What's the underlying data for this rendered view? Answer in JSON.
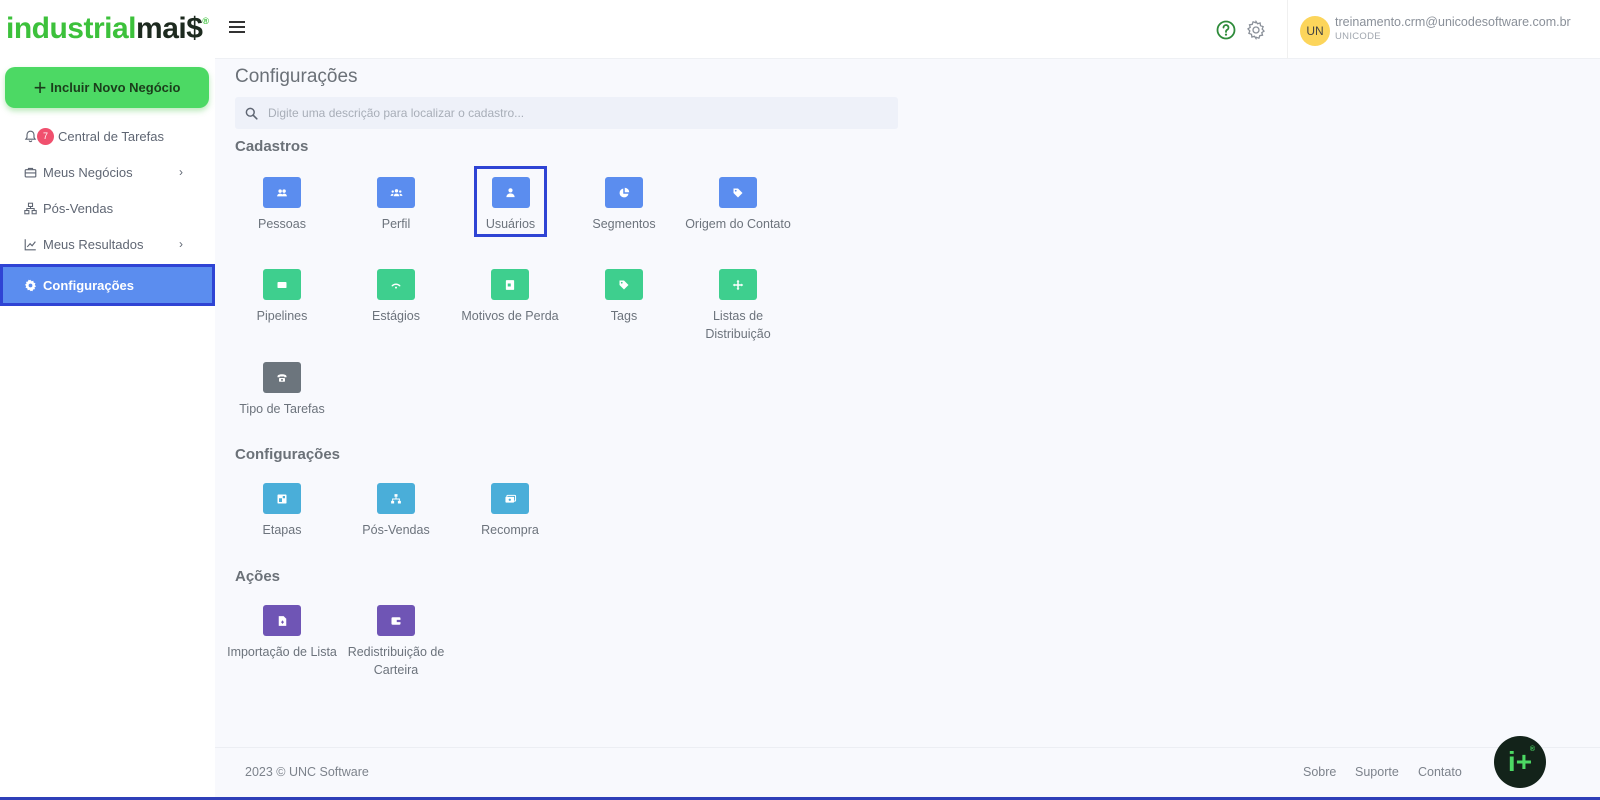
{
  "brand": {
    "logo_part1": "industrial",
    "logo_part2": "mai$",
    "registered": "®"
  },
  "sidebar": {
    "new_deal_label": "Incluir Novo Negócio",
    "items": [
      {
        "label": "Central de Tarefas",
        "badge": "7",
        "icon": "bell-icon"
      },
      {
        "label": "Meus Negócios",
        "icon": "briefcase-icon",
        "has_chevron": true
      },
      {
        "label": "Pós-Vendas",
        "icon": "sitemap-icon"
      },
      {
        "label": "Meus Resultados",
        "icon": "chart-line-icon",
        "has_chevron": true
      },
      {
        "label": "Configurações",
        "icon": "gear-icon",
        "active": true
      }
    ],
    "chevron": "›"
  },
  "header": {
    "user_initials": "UN",
    "user_email": "treinamento.crm@unicodesoftware.com.br",
    "user_org": "UNICODE"
  },
  "main": {
    "title": "Configurações",
    "search_placeholder": "Digite uma descrição para localizar o cadastro...",
    "sections": [
      {
        "title": "Cadastros",
        "tiles": [
          {
            "label": "Pessoas",
            "color": "#5b8def",
            "icon": "users-icon"
          },
          {
            "label": "Perfil",
            "color": "#5b8def",
            "icon": "group-icon"
          },
          {
            "label": "Usuários",
            "color": "#5b8def",
            "icon": "user-icon",
            "selected": true
          },
          {
            "label": "Segmentos",
            "color": "#5b8def",
            "icon": "pie-chart-icon"
          },
          {
            "label": "Origem do Contato",
            "color": "#5b8def",
            "icon": "tag-icon"
          },
          {
            "label": "Pipelines",
            "color": "#3ecf8e",
            "icon": "columns-icon"
          },
          {
            "label": "Estágios",
            "color": "#3ecf8e",
            "icon": "signal-icon"
          },
          {
            "label": "Motivos de Perda",
            "color": "#3ecf8e",
            "icon": "document-icon"
          },
          {
            "label": "Tags",
            "color": "#3ecf8e",
            "icon": "tag-icon"
          },
          {
            "label": "Listas de Distribuição",
            "color": "#3ecf8e",
            "icon": "arrows-icon"
          },
          {
            "label": "Tipo de Tarefas",
            "color": "#6c757d",
            "icon": "phone-icon"
          }
        ]
      },
      {
        "title": "Configurações",
        "tiles": [
          {
            "label": "Etapas",
            "color": "#4aaed9",
            "icon": "layout-icon"
          },
          {
            "label": "Pós-Vendas",
            "color": "#4aaed9",
            "icon": "sitemap-icon"
          },
          {
            "label": "Recompra",
            "color": "#4aaed9",
            "icon": "money-icon"
          }
        ]
      },
      {
        "title": "Ações",
        "tiles": [
          {
            "label": "Importação de Lista",
            "color": "#6f55b5",
            "icon": "file-import-icon"
          },
          {
            "label": "Redistribuição de Carteira",
            "color": "#6f55b5",
            "icon": "wallet-icon"
          }
        ]
      }
    ]
  },
  "footer": {
    "copyright": "2023 © UNC Software",
    "links": [
      "Sobre",
      "Suporte",
      "Contato"
    ]
  },
  "fab": {
    "label": "i+",
    "registered": "®"
  }
}
